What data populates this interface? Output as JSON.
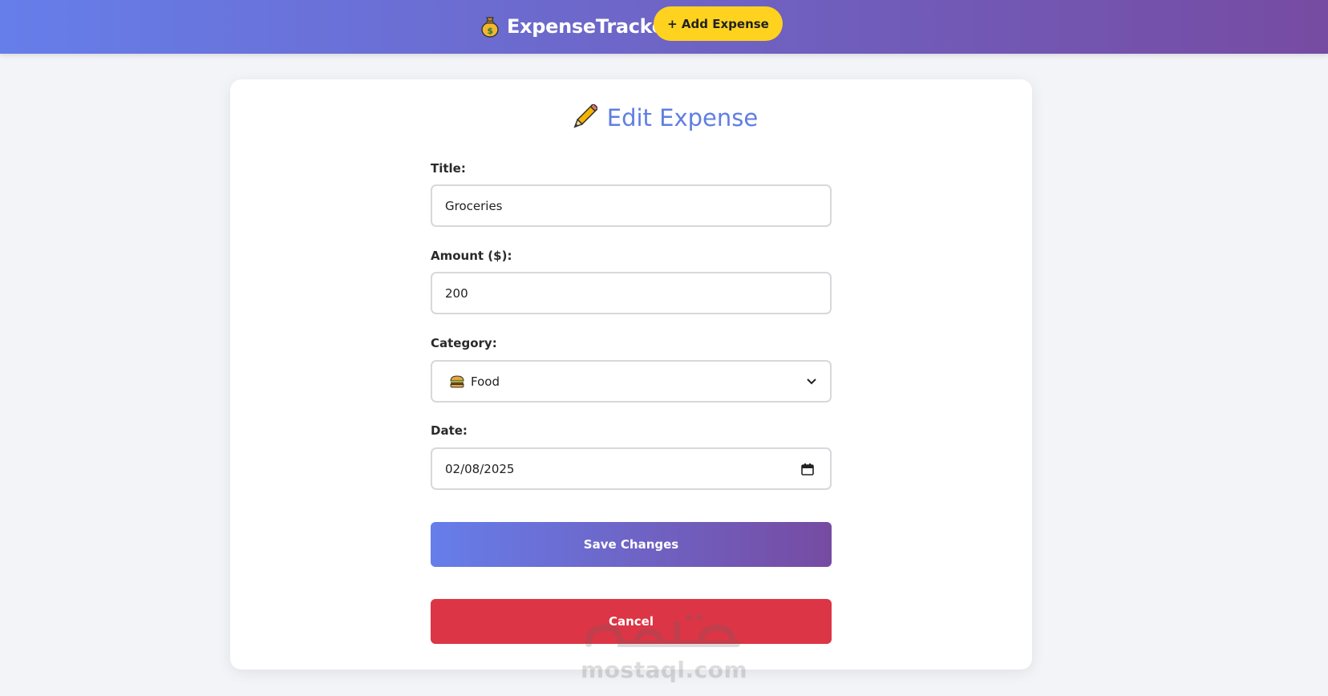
{
  "navbar": {
    "brand_icon": "money-bag-icon",
    "brand_name": "ExpenseTracker",
    "add_button_label": "+ Add Expense",
    "gradient_start": "#667eea",
    "gradient_end": "#764ba2",
    "add_button_color": "#ffd21f"
  },
  "form": {
    "title_icon": "pencil-icon",
    "title": "Edit Expense",
    "title_color": "#5f7ee3",
    "fields": {
      "title": {
        "label": "Title:",
        "value": "Groceries"
      },
      "amount": {
        "label": "Amount ($):",
        "value": "200"
      },
      "category": {
        "label": "Category:",
        "icon": "burger-icon",
        "value": "Food"
      },
      "date": {
        "label": "Date:",
        "value": "02/08/2025"
      }
    },
    "save_label": "Save Changes",
    "cancel_label": "Cancel",
    "cancel_color": "#dc3545"
  },
  "watermark": {
    "text": "mostaql.com"
  }
}
